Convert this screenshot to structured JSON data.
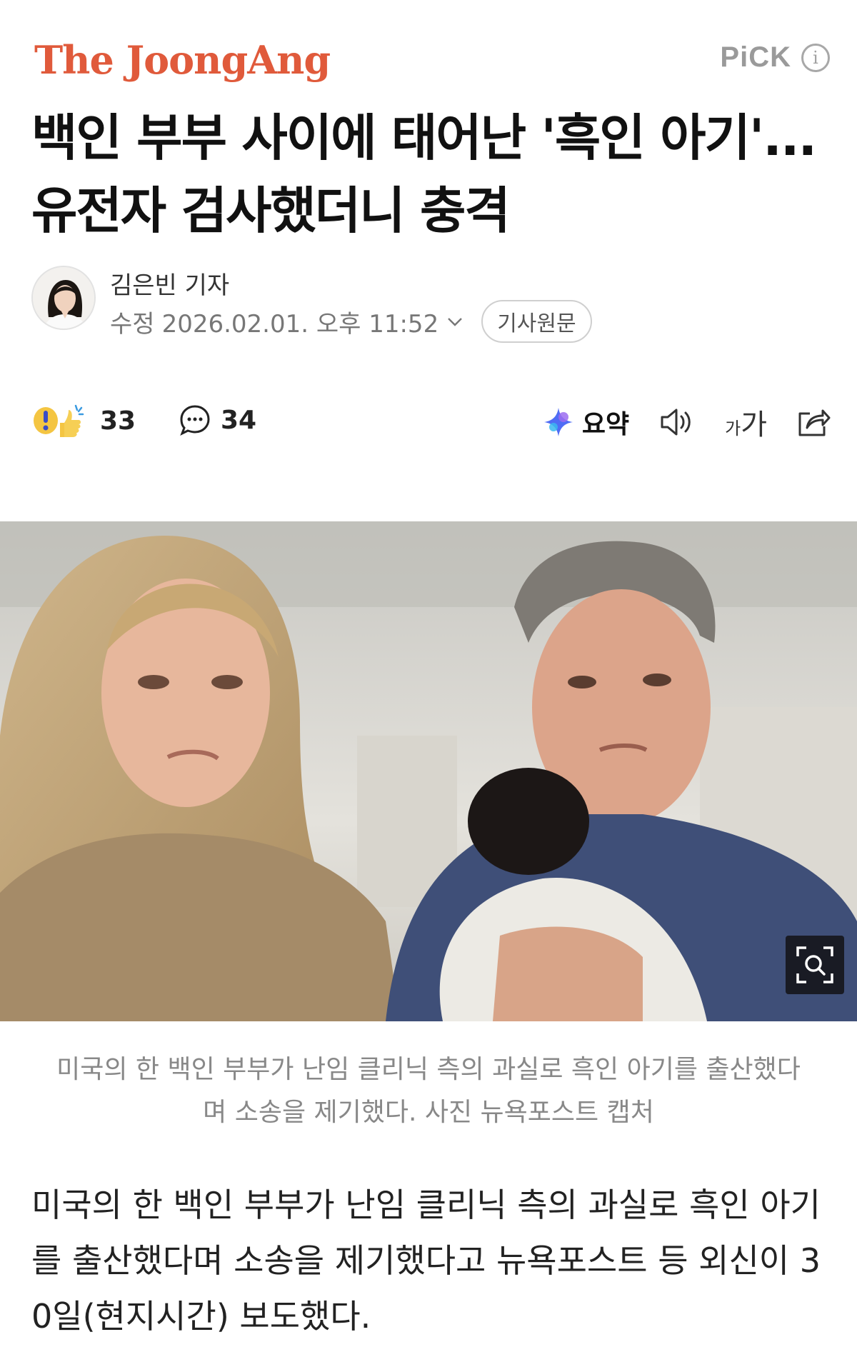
{
  "header": {
    "logo": "The JoongAng",
    "logo_color": "#E05A3B",
    "pick_label": "PiCK",
    "info_icon": "info-icon"
  },
  "article": {
    "headline_lines": [
      "백인 부부 사이에 태어난 '흑인 아기'...",
      "유전자 검사했더니 충격"
    ],
    "reporter": "김은빈 기자",
    "modified_label": "수정",
    "timestamp": "2026.02.01. 오후 11:52",
    "original_button": "기사원문"
  },
  "actions": {
    "reaction_count": "33",
    "comment_count": "34",
    "summary_label": "요약",
    "fontsize_small": "가",
    "fontsize_large": "가"
  },
  "image": {
    "caption_lines": [
      "미국의 한 백인 부부가 난임 클리닉 측의 과실로 흑인 아기를 출산했다",
      "며 소송을 제기했다. 사진 뉴욕포스트 캡처"
    ]
  },
  "body": {
    "lines": [
      "미국의 한 백인 부부가 난임 클리닉 측의 과실로 흑인 아기",
      "를 출산했다며 소송을 제기했다고 뉴욕포스트 등 외신이 3",
      "0일(현지시간) 보도했다."
    ]
  }
}
